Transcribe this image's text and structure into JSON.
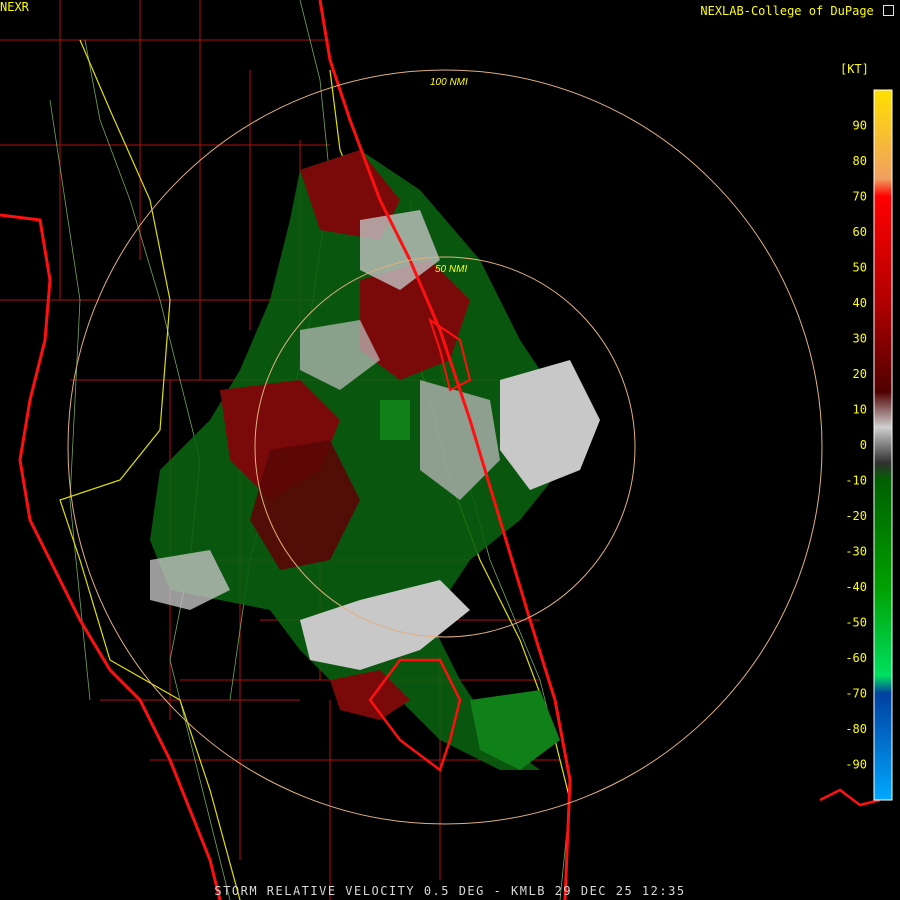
{
  "header": {
    "brand": "NEXLAB-College of DuPage",
    "product": "NEXR",
    "unit": "[KT]"
  },
  "footer": {
    "caption": "STORM RELATIVE VELOCITY 0.5 DEG - KMLB 29 DEC 25 12:35"
  },
  "range_rings": [
    {
      "label": "100 NMI"
    },
    {
      "label": "50 NMI"
    }
  ],
  "color_scale": {
    "ticks": [
      "90",
      "80",
      "70",
      "60",
      "50",
      "40",
      "30",
      "20",
      "10",
      "0",
      "-10",
      "-20",
      "-30",
      "-40",
      "-50",
      "-60",
      "-70",
      "-80",
      "-90"
    ],
    "stops": [
      {
        "value": 100,
        "color": "#ffe000"
      },
      {
        "value": 75,
        "color": "#f0a060"
      },
      {
        "value": 70,
        "color": "#ff0000"
      },
      {
        "value": 40,
        "color": "#b00000"
      },
      {
        "value": 15,
        "color": "#500000"
      },
      {
        "value": 5,
        "color": "#d0d0d0"
      },
      {
        "value": -5,
        "color": "#303030"
      },
      {
        "value": -10,
        "color": "#006000"
      },
      {
        "value": -40,
        "color": "#00a000"
      },
      {
        "value": -65,
        "color": "#00e060"
      },
      {
        "value": -70,
        "color": "#0040a0"
      },
      {
        "value": -100,
        "color": "#00a8ff"
      }
    ]
  },
  "legend_icon": "cursor-corner-icon"
}
